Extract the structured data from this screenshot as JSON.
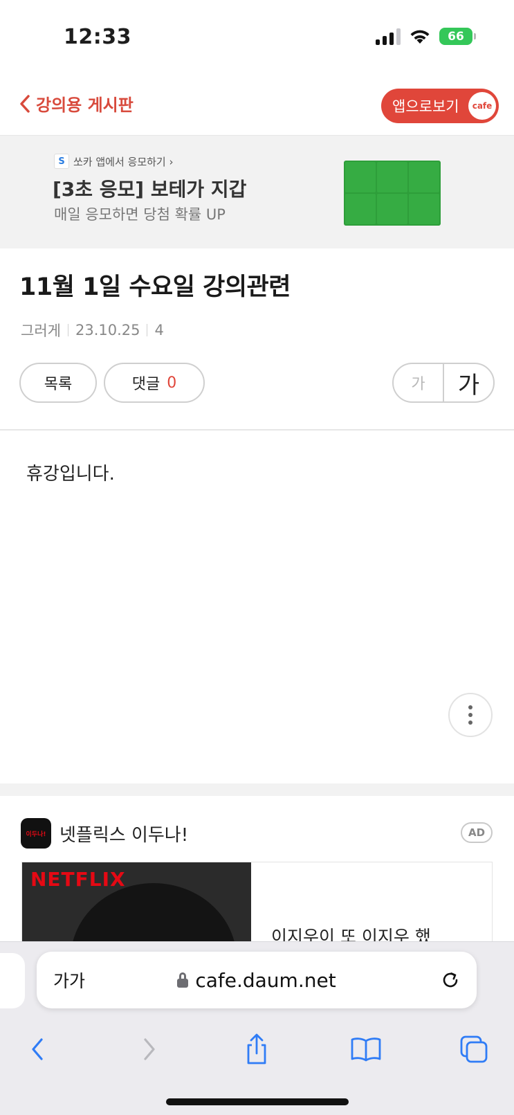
{
  "status_bar": {
    "time": "12:33",
    "battery": "66"
  },
  "nav": {
    "back_label": "강의용 게시판",
    "app_button_label": "앱으로보기",
    "cafe_badge": "cafe"
  },
  "ad_banner": {
    "source_logo": "S",
    "source": "쏘카 앱에서 응모하기 ›",
    "title": "[3초 응모] 보테가 지갑",
    "subtitle": "매일 응모하면 당첨 확률 UP"
  },
  "post": {
    "title": "11월 1일 수요일 강의관련",
    "author": "그러게",
    "date": "23.10.25",
    "views": "4",
    "body": "휴강입니다."
  },
  "actions": {
    "list_label": "목록",
    "comment_label": "댓글",
    "comment_count": "0",
    "font_small": "가",
    "font_large": "가"
  },
  "ad2": {
    "logo_text": "이두나!",
    "name": "넷플릭스 이두나!",
    "badge": "AD",
    "image_brand": "NETFLIX",
    "text": "이지우이 또 이지우 했"
  },
  "browser": {
    "text_size_label": "가가",
    "url": "cafe.daum.net"
  },
  "colors": {
    "accent": "#e0463a",
    "ios_blue": "#2f7cf6",
    "battery_green": "#34c759"
  }
}
